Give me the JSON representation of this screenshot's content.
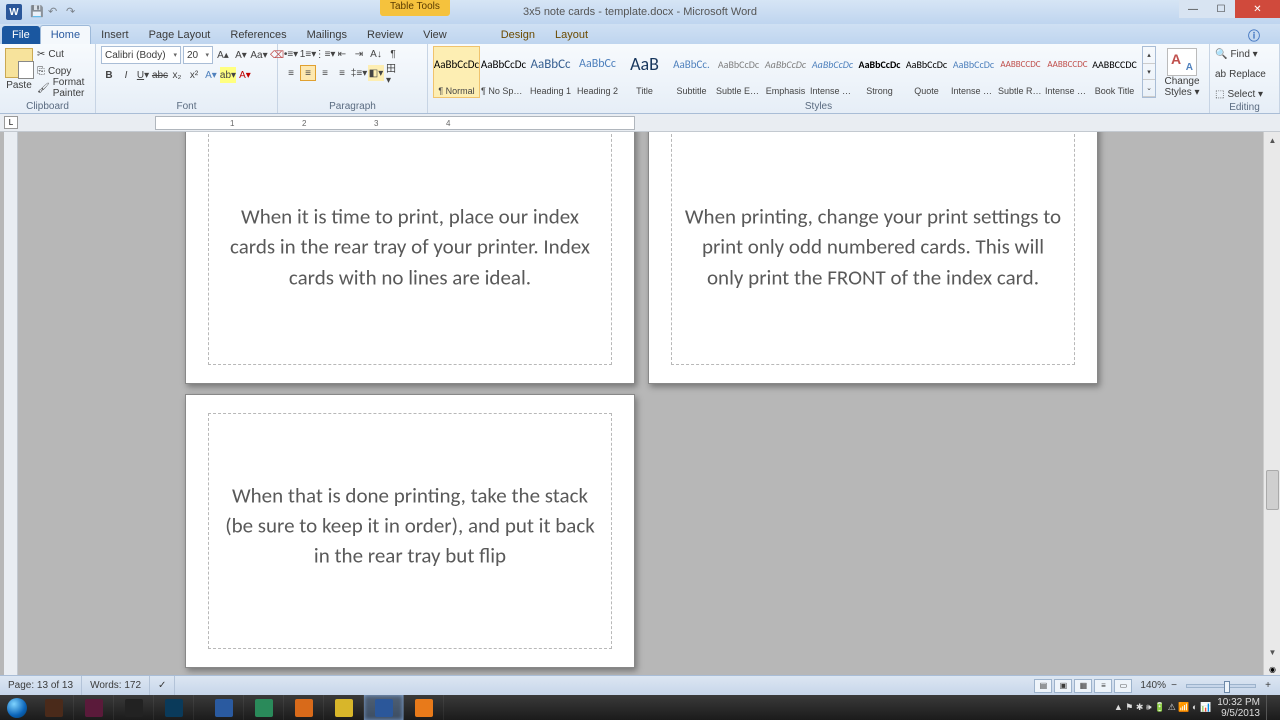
{
  "title": "3x5 note cards - template.docx - Microsoft Word",
  "table_tools": "Table Tools",
  "tabs": {
    "file": "File",
    "home": "Home",
    "insert": "Insert",
    "pagelayout": "Page Layout",
    "references": "References",
    "mailings": "Mailings",
    "review": "Review",
    "view": "View",
    "design": "Design",
    "layout": "Layout"
  },
  "clipboard": {
    "paste": "Paste",
    "cut": "Cut",
    "copy": "Copy",
    "formatpainter": "Format Painter",
    "label": "Clipboard"
  },
  "font": {
    "name": "Calibri (Body)",
    "size": "20",
    "label": "Font"
  },
  "paragraph": {
    "label": "Paragraph"
  },
  "styles": {
    "label": "Styles",
    "items": [
      {
        "preview": "AaBbCcDc",
        "label": "¶ Normal"
      },
      {
        "preview": "AaBbCcDc",
        "label": "¶ No Spaci..."
      },
      {
        "preview": "AaBbCc",
        "label": "Heading 1"
      },
      {
        "preview": "AaBbCc",
        "label": "Heading 2"
      },
      {
        "preview": "AaB",
        "label": "Title"
      },
      {
        "preview": "AaBbCc.",
        "label": "Subtitle"
      },
      {
        "preview": "AaBbCcDc",
        "label": "Subtle Em..."
      },
      {
        "preview": "AaBbCcDc",
        "label": "Emphasis"
      },
      {
        "preview": "AaBbCcDc",
        "label": "Intense E..."
      },
      {
        "preview": "AaBbCcDc",
        "label": "Strong"
      },
      {
        "preview": "AaBbCcDc",
        "label": "Quote"
      },
      {
        "preview": "AaBbCcDc",
        "label": "Intense Q..."
      },
      {
        "preview": "AABBCCDC",
        "label": "Subtle Ref..."
      },
      {
        "preview": "AABBCCDC",
        "label": "Intense R..."
      },
      {
        "preview": "AABBCCDC",
        "label": "Book Title"
      }
    ],
    "change": "Change Styles ▾"
  },
  "editing": {
    "find": "Find ▾",
    "replace": "Replace",
    "select": "Select ▾",
    "label": "Editing"
  },
  "cards": {
    "c1": "When it is time to print, place our index cards in the rear tray of your printer.  Index cards with no lines are ideal.",
    "c2": "When printing, change your print settings to print only odd numbered cards.  This will only print the FRONT of the index card.",
    "c3": "When that is done printing, take the stack (be sure to keep it in order), and put it back in the rear tray but flip"
  },
  "status": {
    "page": "Page: 13 of 13",
    "words": "Words: 172",
    "zoom": "140%"
  },
  "tray": {
    "time": "10:32 PM",
    "date": "9/5/2013"
  }
}
